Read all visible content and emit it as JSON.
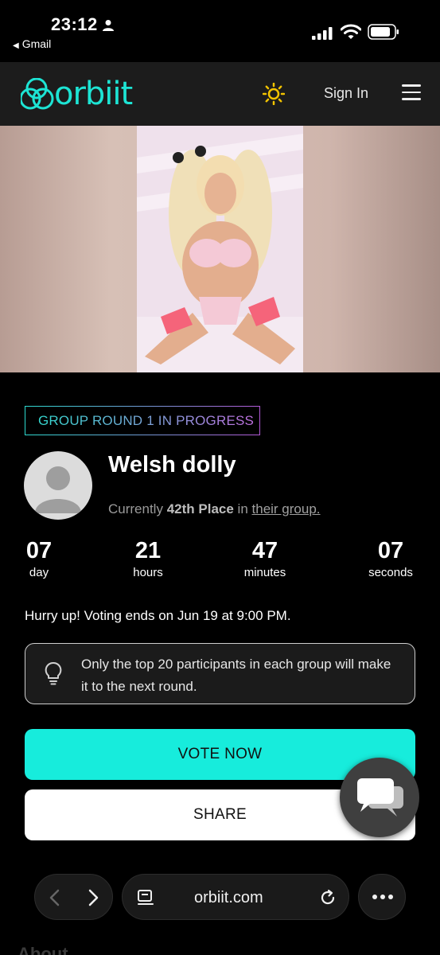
{
  "status_bar": {
    "time": "23:12",
    "back_app": "Gmail"
  },
  "header": {
    "logo_text": "orbiit",
    "theme_icon": "sun-icon",
    "sign_in": "Sign In",
    "menu_icon": "hamburger-menu-icon",
    "accent": "#1de4d4"
  },
  "contest": {
    "badge": "GROUP ROUND 1 IN PROGRESS",
    "name": "Welsh dolly",
    "place_prefix": "Currently",
    "place_value": "42th Place",
    "place_middle": "in",
    "place_link": "their group."
  },
  "countdown": [
    {
      "value": "07",
      "unit": "day"
    },
    {
      "value": "21",
      "unit": "hours"
    },
    {
      "value": "47",
      "unit": "minutes"
    },
    {
      "value": "07",
      "unit": "seconds"
    }
  ],
  "hurry_text": "Hurry up!  Voting ends on Jun 19 at 9:00 PM.",
  "info_text": "Only the top 20 participants in each group will make it to the next round.",
  "buttons": {
    "vote": "VOTE NOW",
    "share": "SHARE",
    "vote_color": "#17ecdc"
  },
  "browser": {
    "url": "orbiit.com"
  },
  "cutoff_text": "About"
}
